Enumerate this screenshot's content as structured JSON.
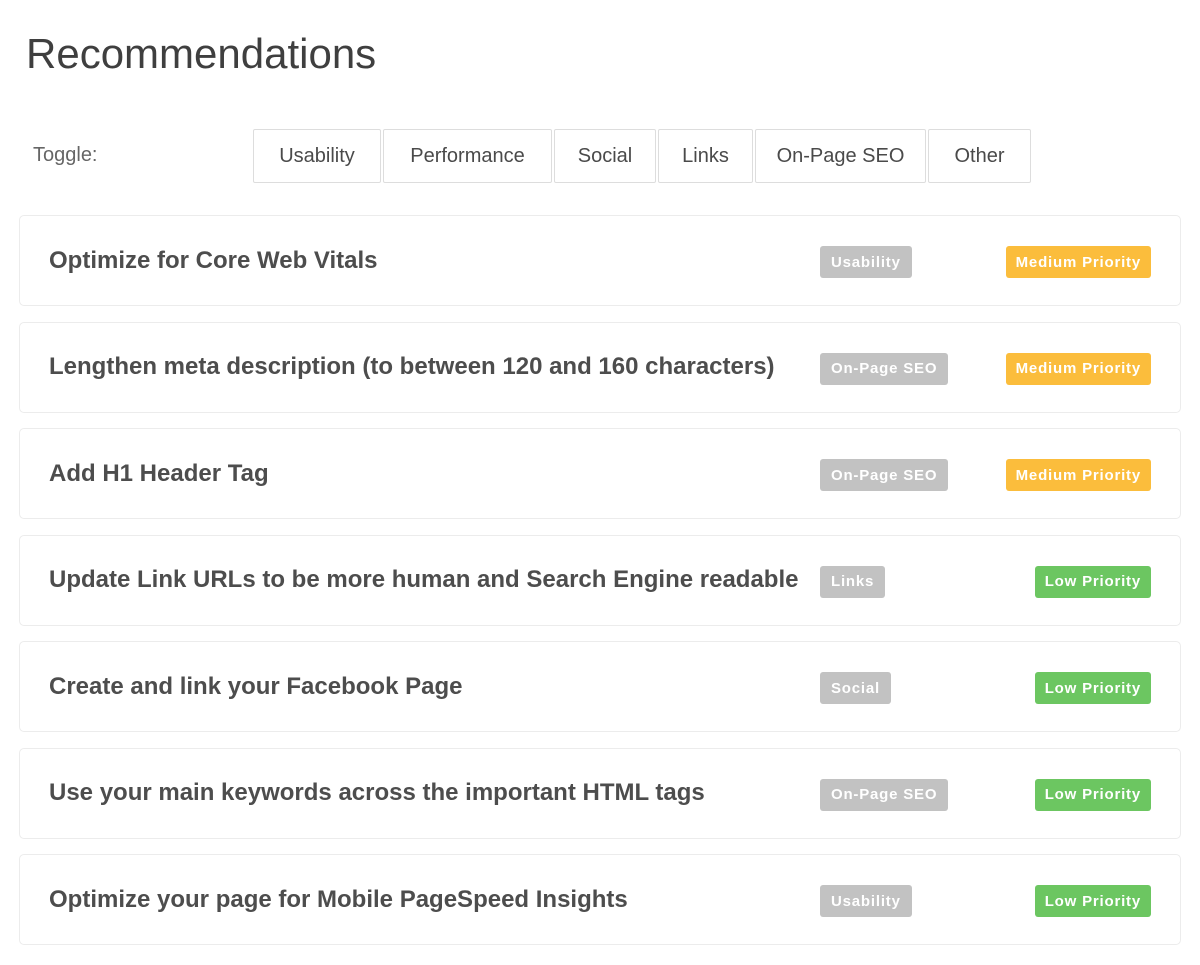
{
  "header": {
    "title": "Recommendations"
  },
  "toggle": {
    "label": "Toggle:",
    "buttons": [
      "Usability",
      "Performance",
      "Social",
      "Links",
      "On-Page SEO",
      "Other"
    ]
  },
  "colors": {
    "category_badge": "#c2c2c2",
    "medium_priority": "#fbbd3c",
    "low_priority": "#6cc661"
  },
  "recommendations": [
    {
      "title": "Optimize for Core Web Vitals",
      "category": "Usability",
      "priority": "Medium Priority"
    },
    {
      "title": "Lengthen meta description (to between 120 and 160 characters)",
      "category": "On-Page SEO",
      "priority": "Medium Priority"
    },
    {
      "title": "Add H1 Header Tag",
      "category": "On-Page SEO",
      "priority": "Medium Priority"
    },
    {
      "title": "Update Link URLs to be more human and Search Engine readable",
      "category": "Links",
      "priority": "Low Priority"
    },
    {
      "title": "Create and link your Facebook Page",
      "category": "Social",
      "priority": "Low Priority"
    },
    {
      "title": "Use your main keywords across the important HTML tags",
      "category": "On-Page SEO",
      "priority": "Low Priority"
    },
    {
      "title": "Optimize your page for Mobile PageSpeed Insights",
      "category": "Usability",
      "priority": "Low Priority"
    }
  ]
}
